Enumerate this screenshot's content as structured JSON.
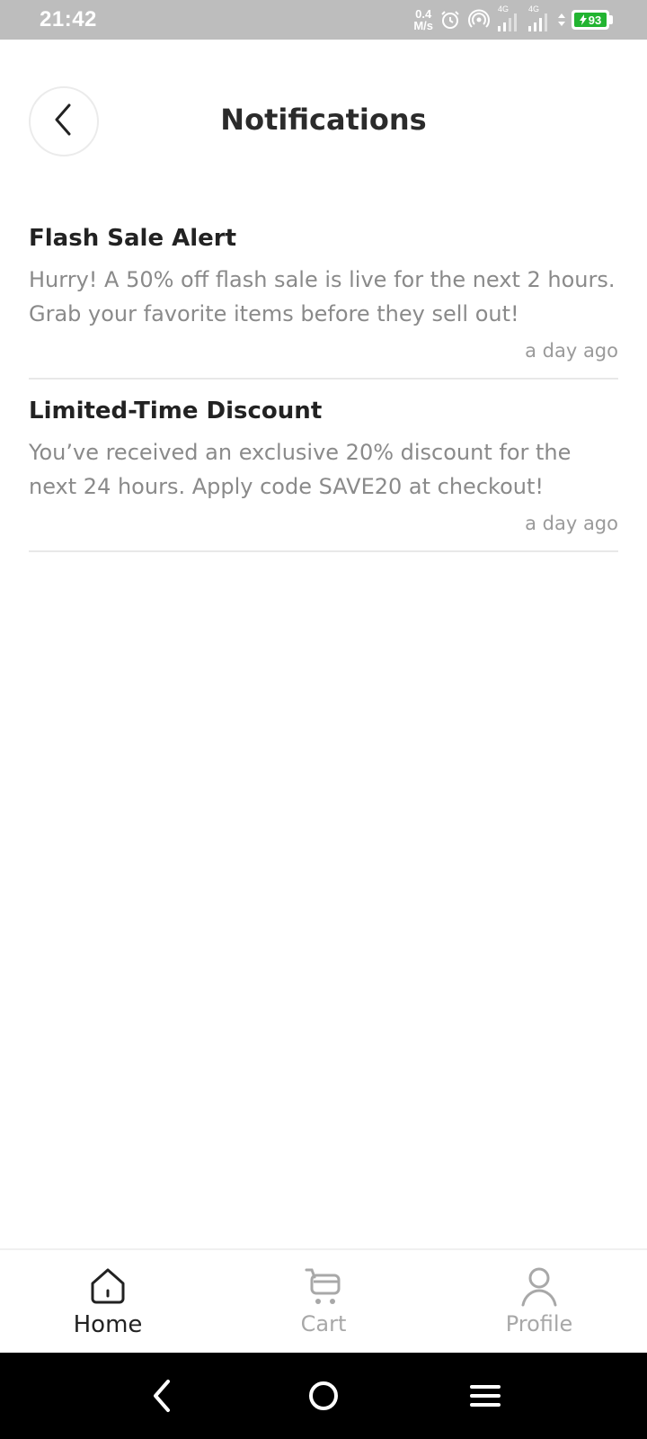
{
  "status_bar": {
    "time": "21:42",
    "net_speed_value": "0.4",
    "net_speed_unit": "M/s",
    "sim1_label": "4G",
    "sim2_label": "4G",
    "battery_level": "93",
    "icons": [
      "alarm-icon",
      "hotspot-icon",
      "signal-icon",
      "signal-icon",
      "data-arrows-icon",
      "battery-charging-icon"
    ]
  },
  "header": {
    "title": "Notifications",
    "back_icon": "chevron-left-icon"
  },
  "notifications": [
    {
      "title": "Flash Sale Alert",
      "body": "Hurry! A 50% off flash sale is live for the next 2 hours. Grab your favorite items before they sell out!",
      "time": "a day ago"
    },
    {
      "title": "Limited-Time Discount",
      "body": "You’ve received an exclusive 20% discount for the next 24 hours. Apply code SAVE20 at checkout!",
      "time": "a day ago"
    }
  ],
  "bottom_nav": {
    "items": [
      {
        "label": "Home",
        "icon": "home-icon",
        "active": true
      },
      {
        "label": "Cart",
        "icon": "cart-icon",
        "active": false
      },
      {
        "label": "Profile",
        "icon": "profile-icon",
        "active": false
      }
    ]
  },
  "system_nav": {
    "icons": [
      "back-icon",
      "home-circle-icon",
      "menu-icon"
    ]
  },
  "colors": {
    "status_bar_bg": "#bdbdbd",
    "battery_green": "#22b431",
    "title_text": "#222222",
    "body_text": "#8a8a8a",
    "inactive_nav": "#a8a8a8"
  }
}
